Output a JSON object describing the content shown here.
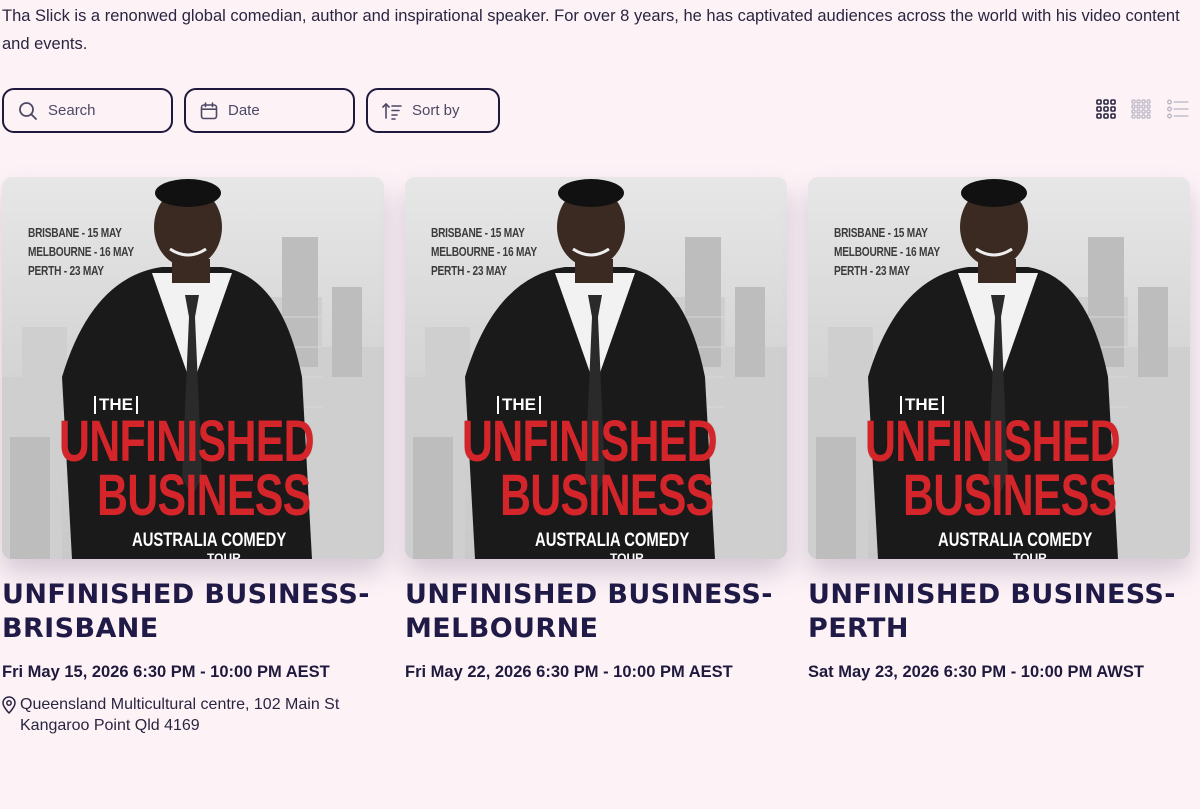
{
  "description": "Tha Slick is a renonwed global comedian, author and inspirational speaker. For over 8 years, he has captivated audiences across  the world with his video content and events.",
  "filters": {
    "search_placeholder": "Search",
    "date_placeholder": "Date",
    "sort_label": "Sort by"
  },
  "view_modes": [
    {
      "name": "grid-3",
      "active": true
    },
    {
      "name": "grid-4",
      "active": false
    },
    {
      "name": "list",
      "active": false
    }
  ],
  "poster": {
    "cities": [
      "BRISBANE - 15 MAY",
      "MELBOURNE - 16 MAY",
      "PERTH - 23 MAY"
    ],
    "the": "THE",
    "line1": "UNFINISHED",
    "line2": "BUSINESS",
    "sub_bold": "AUSTRALIA",
    "sub_rest": " COMEDY",
    "tour": "TOUR"
  },
  "events": [
    {
      "title": "UNFINISHED BUSINESS- BRISBANE",
      "datetime": "Fri May 15, 2026 6:30 PM - 10:00 PM AEST",
      "location_line1": "Queensland Multicultural centre, 102 Main St",
      "location_line2": "Kangaroo Point Qld 4169"
    },
    {
      "title": "UNFINISHED BUSINESS- MELBOURNE",
      "datetime": "Fri May 22, 2026 6:30 PM - 10:00 PM AEST"
    },
    {
      "title": "UNFINISHED BUSINESS- PERTH",
      "datetime": "Sat May 23, 2026 6:30 PM - 10:00 PM AWST"
    }
  ],
  "colors": {
    "background": "#fdf3f7",
    "primary": "#1f1a3d",
    "poster_red": "#d4252a"
  }
}
